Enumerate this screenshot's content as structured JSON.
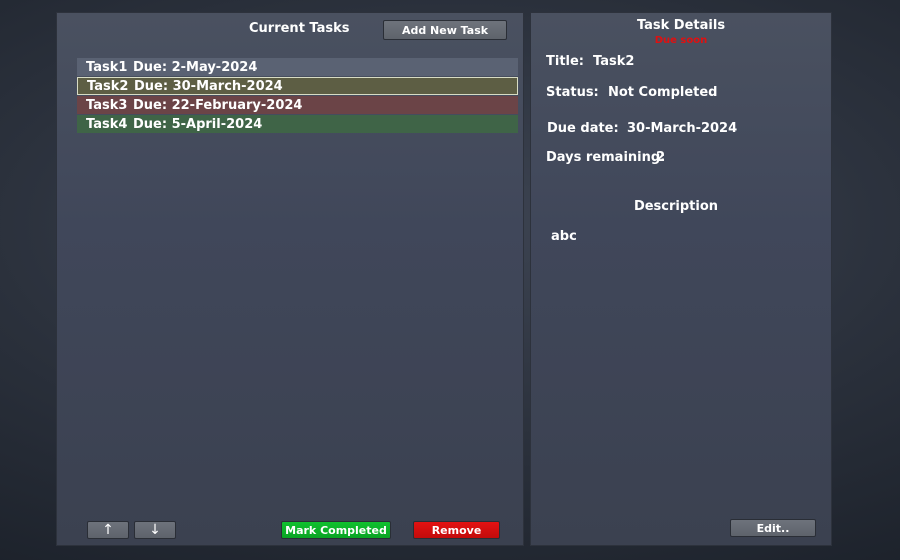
{
  "current_tasks": {
    "title": "Current Tasks",
    "add_button": "Add New Task",
    "tasks": [
      {
        "name": "Task1",
        "due": "Due: 2-May-2024"
      },
      {
        "name": "Task2",
        "due": "Due: 30-March-2024"
      },
      {
        "name": "Task3",
        "due": "Due: 22-February-2024"
      },
      {
        "name": "Task4",
        "due": "Due: 5-April-2024"
      }
    ],
    "up_label": "↑",
    "down_label": "↓",
    "mark_completed_label": "Mark Completed",
    "remove_label": "Remove"
  },
  "task_details": {
    "title": "Task Details",
    "due_soon": "Due soon",
    "title_label": "Title:",
    "title_value": "Task2",
    "status_label": "Status:",
    "status_value": "Not Completed",
    "due_date_label": "Due date:",
    "due_date_value": "30-March-2024",
    "days_remaining_label": "Days remaining:",
    "days_remaining_value": "2",
    "description_heading": "Description",
    "description_text": "abc",
    "edit_label": "Edit.."
  },
  "colors": {
    "row_default": "#5a6273",
    "row_selected": "#5d5e44",
    "row_overdue": "#6b4447",
    "row_upcoming": "#3f6447",
    "due_soon": "#e01010",
    "mark_completed": "#10c12e",
    "remove": "#e31212"
  }
}
